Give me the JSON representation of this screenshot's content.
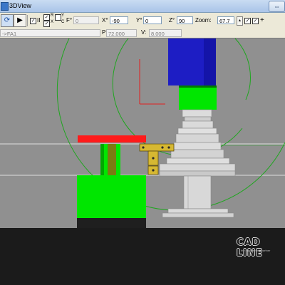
{
  "window": {
    "title": "3DView",
    "restore_symbol": "⇔"
  },
  "toolbar": {
    "play_symbol": "▶",
    "check_ii_label": "II",
    "small_labels": [
      "R",
      "X",
      "Y",
      "C"
    ],
    "f_label": "F°",
    "f_value": "0",
    "x_label": "X°",
    "x_value": "-90",
    "y_label": "Y°",
    "y_value": "0",
    "z_label": "Z°",
    "z_value": "90",
    "zoom_label": "Zoom:",
    "zoom_value": "67.7",
    "plus_label": "+"
  },
  "toolbar2": {
    "program_field": "->FA1",
    "p_label": "P:",
    "p_value": "72.000",
    "v_label": "V:",
    "v_value": "8.000"
  },
  "scene": {
    "watermark": "CAD LINE",
    "watermark_tag": "the engineering partner",
    "colors": {
      "background": "#909090",
      "floor": "#1b1b1b",
      "spindle_head": "#1d1dc4",
      "green_part": "#00e600",
      "red_bar": "#ff1a1a",
      "gripper": "#d6b832",
      "circle_outline": "#1fa61f",
      "machine_gray": "#d2d2d2"
    }
  }
}
